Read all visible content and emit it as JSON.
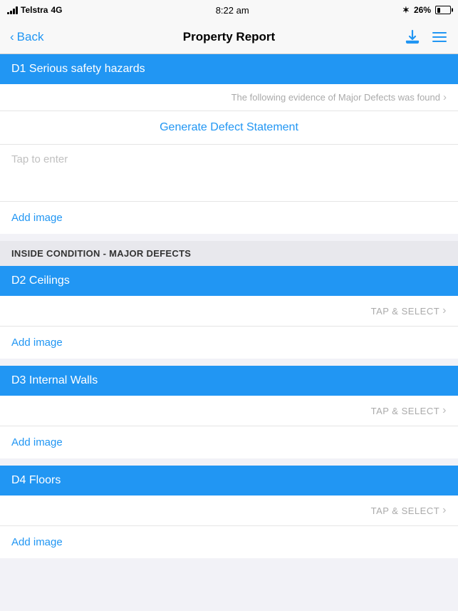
{
  "statusBar": {
    "carrier": "Telstra",
    "network": "4G",
    "time": "8:22 am",
    "bluetooth": "✴",
    "battery": "26%"
  },
  "navBar": {
    "backLabel": "Back",
    "title": "Property Report"
  },
  "sections": [
    {
      "id": "d1",
      "type": "blue-header",
      "label": "D1 Serious safety hazards"
    },
    {
      "id": "d1-defect-row",
      "type": "chevron-row",
      "label": "The following evidence of Major Defects was found"
    },
    {
      "id": "d1-generate",
      "type": "generate-link",
      "label": "Generate Defect Statement"
    },
    {
      "id": "d1-textarea",
      "type": "textarea",
      "placeholder": "Tap to enter"
    },
    {
      "id": "d1-add-image",
      "type": "add-image",
      "label": "Add image"
    },
    {
      "id": "inside-condition-header",
      "type": "gray-header",
      "label": "INSIDE CONDITION - MAJOR DEFECTS"
    },
    {
      "id": "d2",
      "type": "blue-header",
      "label": "D2 Ceilings"
    },
    {
      "id": "d2-tap-select",
      "type": "tap-select",
      "label": "TAP & SELECT"
    },
    {
      "id": "d2-add-image",
      "type": "add-image",
      "label": "Add image"
    },
    {
      "id": "d3",
      "type": "blue-header",
      "label": "D3 Internal Walls"
    },
    {
      "id": "d3-tap-select",
      "type": "tap-select",
      "label": "TAP & SELECT"
    },
    {
      "id": "d3-add-image",
      "type": "add-image",
      "label": "Add image"
    },
    {
      "id": "d4",
      "type": "blue-header",
      "label": "D4 Floors"
    },
    {
      "id": "d4-tap-select",
      "type": "tap-select",
      "label": "TAP & SELECT"
    },
    {
      "id": "d4-add-image",
      "type": "add-image",
      "label": "Add image"
    }
  ],
  "colors": {
    "blue": "#2196F3",
    "grayHeader": "#e8e8ed"
  }
}
